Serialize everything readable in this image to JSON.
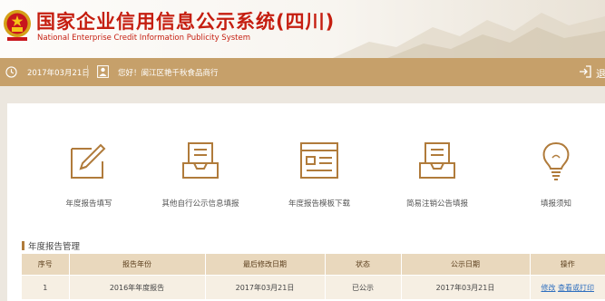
{
  "header": {
    "title_cn": "国家企业信用信息公示系统(四川)",
    "title_en": "National Enterprise Credit Information Publicity System",
    "colors": {
      "title": "#c51e10",
      "bar": "#c6a06a",
      "accent": "#b07b3b",
      "link": "#2f6fbf"
    }
  },
  "topbar": {
    "date": "2017年03月21日",
    "greeting": "您好！阆江区艳千秋食品商行",
    "exit_letter": "退",
    "icons": [
      "clock-icon",
      "user-icon",
      "exit-icon"
    ]
  },
  "tiles": [
    {
      "label": "年度报告填写",
      "icon": "edit-form-icon"
    },
    {
      "label": "其他自行公示信息填报",
      "icon": "inbox-tray-icon"
    },
    {
      "label": "年度报告模板下载",
      "icon": "browser-template-icon"
    },
    {
      "label": "简易注销公告填报",
      "icon": "inbox-tray-icon"
    },
    {
      "label": "填报须知",
      "icon": "lightbulb-icon"
    }
  ],
  "section": {
    "title": "年度报告管理",
    "columns": [
      "序号",
      "报告年份",
      "最后修改日期",
      "状态",
      "公示日期",
      "操作"
    ],
    "rows": [
      {
        "index": "1",
        "year": "2016年年度报告",
        "modified": "2017年03月21日",
        "status": "已公示",
        "published": "2017年03月21日",
        "actions": [
          "修改",
          "查看或打印"
        ]
      }
    ]
  }
}
